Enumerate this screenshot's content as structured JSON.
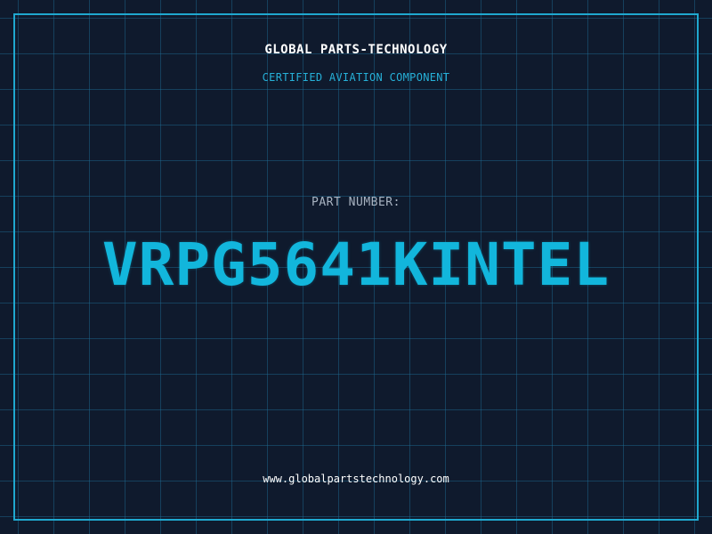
{
  "header": {
    "brand": "GLOBAL PARTS-TECHNOLOGY",
    "subtitle": "CERTIFIED AVIATION COMPONENT"
  },
  "main": {
    "label": "PART NUMBER:",
    "part_number": "VRPG5641KINTEL"
  },
  "footer": {
    "url": "www.globalpartstechnology.com"
  },
  "colors": {
    "background": "#0f1a2d",
    "grid": "#1e6e96",
    "accent": "#12b6dc",
    "frame": "#1fa8cf",
    "label": "#a9b4c2",
    "text": "#ffffff"
  }
}
